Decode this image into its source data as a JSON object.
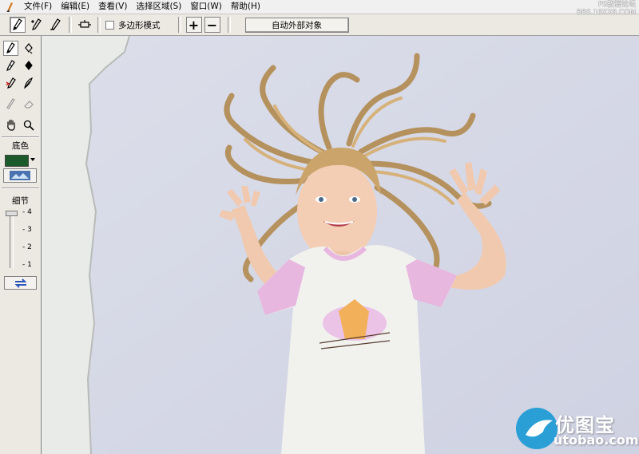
{
  "menu": {
    "items": [
      "文件(F)",
      "编辑(E)",
      "查看(V)",
      "选择区域(S)",
      "窗口(W)",
      "帮助(H)"
    ]
  },
  "watermark_top": {
    "line1": "PS教程论坛",
    "line2": "BBS.16XX8.COM"
  },
  "toolbar": {
    "polygon_mode_label": "多边形模式",
    "polygon_mode_checked": false,
    "plus_label": "+",
    "minus_label": "−",
    "auto_button_label": "自动外部对象"
  },
  "left_panel": {
    "base_color_label": "底色",
    "base_color": "#1c5a2c",
    "detail_label": "细节",
    "detail_ticks": [
      "- 4",
      "- 3",
      "- 2",
      "- 1"
    ],
    "detail_level": 4
  },
  "canvas": {
    "background_color": "#d6d8e6"
  },
  "logo_watermark": {
    "title": "优图宝",
    "url": "utobao.com"
  }
}
